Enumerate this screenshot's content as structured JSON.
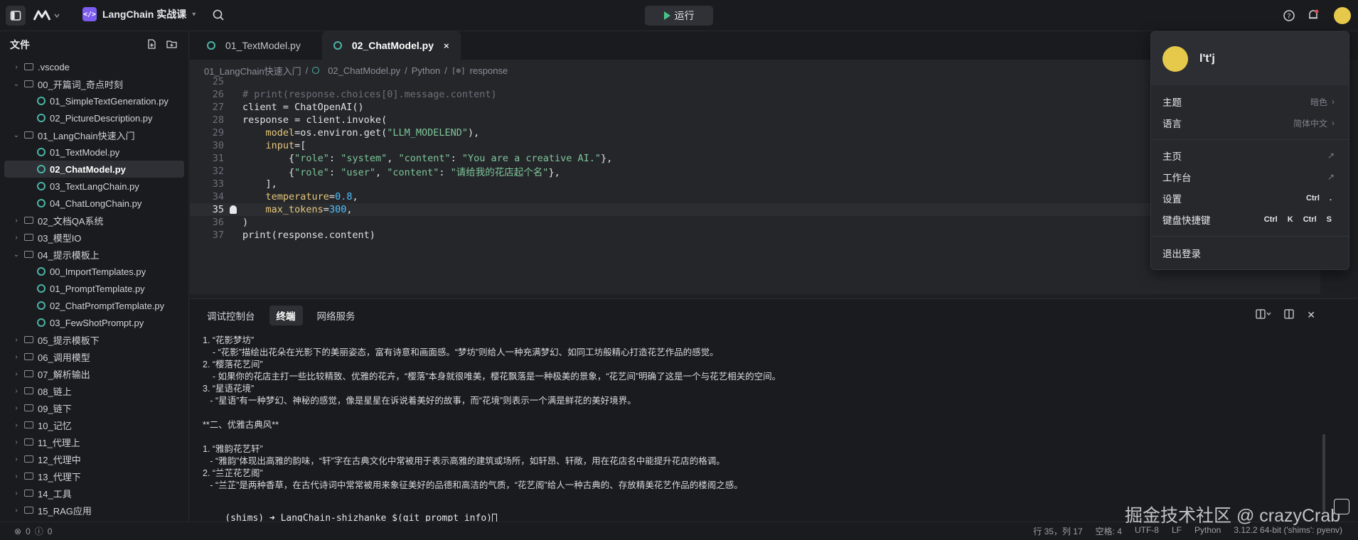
{
  "app": {
    "project_name": "LangChain 实战课",
    "run_label": "运行"
  },
  "sidebar": {
    "title": "文件",
    "items": [
      {
        "label": ".vscode",
        "type": "folder",
        "depth": 0,
        "expanded": false
      },
      {
        "label": "00_开篇词_奇点时刻",
        "type": "folder",
        "depth": 0,
        "expanded": true
      },
      {
        "label": "01_SimpleTextGeneration.py",
        "type": "file",
        "depth": 1
      },
      {
        "label": "02_PictureDescription.py",
        "type": "file",
        "depth": 1
      },
      {
        "label": "01_LangChain快速入门",
        "type": "folder",
        "depth": 0,
        "expanded": true
      },
      {
        "label": "01_TextModel.py",
        "type": "file",
        "depth": 1
      },
      {
        "label": "02_ChatModel.py",
        "type": "file",
        "depth": 1,
        "active": true
      },
      {
        "label": "03_TextLangChain.py",
        "type": "file",
        "depth": 1
      },
      {
        "label": "04_ChatLongChain.py",
        "type": "file",
        "depth": 1
      },
      {
        "label": "02_文档QA系统",
        "type": "folder",
        "depth": 0,
        "expanded": false
      },
      {
        "label": "03_模型IO",
        "type": "folder",
        "depth": 0,
        "expanded": false
      },
      {
        "label": "04_提示模板上",
        "type": "folder",
        "depth": 0,
        "expanded": true
      },
      {
        "label": "00_ImportTemplates.py",
        "type": "file",
        "depth": 1
      },
      {
        "label": "01_PromptTemplate.py",
        "type": "file",
        "depth": 1
      },
      {
        "label": "02_ChatPromptTemplate.py",
        "type": "file",
        "depth": 1
      },
      {
        "label": "03_FewShotPrompt.py",
        "type": "file",
        "depth": 1
      },
      {
        "label": "05_提示模板下",
        "type": "folder",
        "depth": 0,
        "expanded": false
      },
      {
        "label": "06_调用模型",
        "type": "folder",
        "depth": 0,
        "expanded": false
      },
      {
        "label": "07_解析输出",
        "type": "folder",
        "depth": 0,
        "expanded": false
      },
      {
        "label": "08_链上",
        "type": "folder",
        "depth": 0,
        "expanded": false
      },
      {
        "label": "09_链下",
        "type": "folder",
        "depth": 0,
        "expanded": false
      },
      {
        "label": "10_记忆",
        "type": "folder",
        "depth": 0,
        "expanded": false
      },
      {
        "label": "11_代理上",
        "type": "folder",
        "depth": 0,
        "expanded": false
      },
      {
        "label": "12_代理中",
        "type": "folder",
        "depth": 0,
        "expanded": false
      },
      {
        "label": "13_代理下",
        "type": "folder",
        "depth": 0,
        "expanded": false
      },
      {
        "label": "14_工具",
        "type": "folder",
        "depth": 0,
        "expanded": false
      },
      {
        "label": "15_RAG应用",
        "type": "folder",
        "depth": 0,
        "expanded": false
      }
    ]
  },
  "tabs": [
    {
      "label": "01_TextModel.py",
      "active": false
    },
    {
      "label": "02_ChatModel.py",
      "active": true,
      "close": "×"
    }
  ],
  "breadcrumb": [
    "01_LangChain快速入门",
    "/",
    "02_ChatModel.py",
    "/",
    "Python",
    "/",
    "response"
  ],
  "editor": {
    "current_line": 35,
    "lines": [
      {
        "n": "25",
        "segs": []
      },
      {
        "n": "26",
        "segs": [
          {
            "t": "# print(response.choices[0].message.content)",
            "c": "com"
          }
        ]
      },
      {
        "n": "27",
        "segs": [
          {
            "t": "client = ChatOpenAI()",
            "c": "fn"
          }
        ]
      },
      {
        "n": "28",
        "segs": [
          {
            "t": "response = client.invoke(",
            "c": "fn"
          }
        ]
      },
      {
        "n": "29",
        "segs": [
          {
            "t": "    ",
            "c": "fn"
          },
          {
            "t": "model",
            "c": "kw"
          },
          {
            "t": "=os.environ.get(",
            "c": "fn"
          },
          {
            "t": "\"LLM_MODELEND\"",
            "c": "str"
          },
          {
            "t": "),",
            "c": "fn"
          }
        ]
      },
      {
        "n": "30",
        "segs": [
          {
            "t": "    ",
            "c": "fn"
          },
          {
            "t": "input",
            "c": "kw"
          },
          {
            "t": "=[",
            "c": "fn"
          }
        ]
      },
      {
        "n": "31",
        "segs": [
          {
            "t": "        {",
            "c": "fn"
          },
          {
            "t": "\"role\"",
            "c": "str"
          },
          {
            "t": ": ",
            "c": "fn"
          },
          {
            "t": "\"system\"",
            "c": "str"
          },
          {
            "t": ", ",
            "c": "fn"
          },
          {
            "t": "\"content\"",
            "c": "str"
          },
          {
            "t": ": ",
            "c": "fn"
          },
          {
            "t": "\"You are a creative AI.\"",
            "c": "str"
          },
          {
            "t": "},",
            "c": "fn"
          }
        ]
      },
      {
        "n": "32",
        "segs": [
          {
            "t": "        {",
            "c": "fn"
          },
          {
            "t": "\"role\"",
            "c": "str"
          },
          {
            "t": ": ",
            "c": "fn"
          },
          {
            "t": "\"user\"",
            "c": "str"
          },
          {
            "t": ", ",
            "c": "fn"
          },
          {
            "t": "\"content\"",
            "c": "str"
          },
          {
            "t": ": ",
            "c": "fn"
          },
          {
            "t": "\"请给我的花店起个名\"",
            "c": "str"
          },
          {
            "t": "},",
            "c": "fn"
          }
        ]
      },
      {
        "n": "33",
        "segs": [
          {
            "t": "    ],",
            "c": "fn"
          }
        ]
      },
      {
        "n": "34",
        "segs": [
          {
            "t": "    ",
            "c": "fn"
          },
          {
            "t": "temperature",
            "c": "kw"
          },
          {
            "t": "=",
            "c": "fn"
          },
          {
            "t": "0.8",
            "c": "num"
          },
          {
            "t": ",",
            "c": "fn"
          }
        ]
      },
      {
        "n": "35",
        "segs": [
          {
            "t": "    ",
            "c": "fn"
          },
          {
            "t": "max_tokens",
            "c": "kw"
          },
          {
            "t": "=",
            "c": "fn"
          },
          {
            "t": "300",
            "c": "num"
          },
          {
            "t": ",",
            "c": "fn"
          }
        ]
      },
      {
        "n": "36",
        "segs": [
          {
            "t": ")",
            "c": "fn"
          }
        ]
      },
      {
        "n": "37",
        "segs": [
          {
            "t": "print(response.content)",
            "c": "fn"
          }
        ]
      }
    ]
  },
  "panel": {
    "tabs": [
      {
        "label": "调试控制台",
        "active": false
      },
      {
        "label": "终端",
        "active": true
      },
      {
        "label": "网络服务",
        "active": false
      }
    ],
    "terminal_lines": [
      "1. “花影梦坊”",
      "    - “花影”描绘出花朵在光影下的美丽姿态，富有诗意和画面感。“梦坊”则给人一种充满梦幻、如同工坊般精心打造花艺作品的感觉。",
      "2. “樱落花艺间”",
      "    - 如果你的花店主打一些比较精致、优雅的花卉，“樱落”本身就很唯美，樱花飘落是一种极美的景象，“花艺间”明确了这是一个与花艺相关的空间。",
      "3. “星语花境”",
      "   - “星语”有一种梦幻、神秘的感觉，像是星星在诉说着美好的故事，而“花境”则表示一个满是鲜花的美好境界。",
      "",
      "**二、优雅古典风**",
      "",
      "1. “雅韵花艺轩”",
      "   - “雅韵”体现出高雅的韵味，“轩”字在古典文化中常被用于表示高雅的建筑或场所，如轩昂、轩敞，用在花店名中能提升花店的格调。",
      "2. “兰芷花艺阁”",
      "   - “兰芷”是两种香草，在古代诗词中常常被用来象征美好的品德和高洁的气质，“花艺阁”给人一种古典的、存放精美花艺作品的楼阁之感。"
    ],
    "prompt": "(shims) ➜ LangChain-shizhanke $(git_prompt_info)"
  },
  "status": {
    "errors": "0",
    "warnings": "0",
    "position": "行 35，列 17",
    "spaces": "空格: 4",
    "encoding": "UTF-8",
    "eol": "LF",
    "language": "Python",
    "interpreter": "3.12.2 64-bit ('shims': pyenv)"
  },
  "watermark": "掘金技术社区 @ crazyCrab",
  "user_menu": {
    "username": "l't'j",
    "items": [
      {
        "label": "主题",
        "value": "暗色",
        "arrow": "›"
      },
      {
        "label": "语言",
        "value": "简体中文",
        "arrow": "›"
      },
      {
        "label": "主页",
        "arrow": "↗"
      },
      {
        "label": "工作台",
        "arrow": "↗"
      },
      {
        "label": "设置",
        "keys": [
          "Ctrl",
          "."
        ]
      },
      {
        "label": "键盘快捷键",
        "keys": [
          "Ctrl",
          "K",
          "Ctrl",
          "S"
        ]
      },
      {
        "label": "退出登录"
      }
    ]
  }
}
